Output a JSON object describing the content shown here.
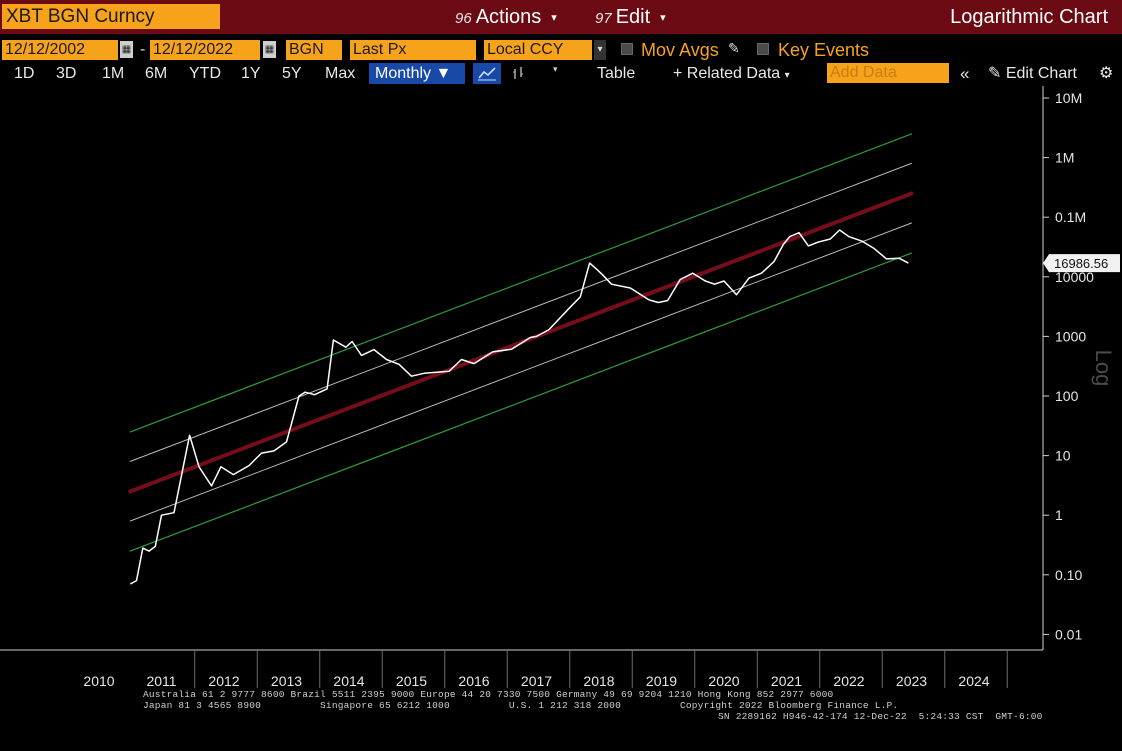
{
  "header": {
    "security": "XBT BGN Curncy",
    "actions_num": "96",
    "actions_label": "Actions",
    "edit_num": "97",
    "edit_label": "Edit",
    "chart_mode": "Logarithmic Chart"
  },
  "params": {
    "start_date": "12/12/2002",
    "end_date": "12/12/2022",
    "source": "BGN",
    "field": "Last Px",
    "currency": "Local CCY",
    "mov_avgs": "Mov Avgs",
    "key_events": "Key Events"
  },
  "toolbar": {
    "ranges": [
      "1D",
      "3D",
      "1M",
      "6M",
      "YTD",
      "1Y",
      "5Y",
      "Max"
    ],
    "period": "Monthly",
    "table": "Table",
    "related_data": "Related Data",
    "add_data": "Add Data",
    "edit_chart": "Edit Chart"
  },
  "footer": {
    "line1": "Australia 61 2 9777 8600 Brazil 5511 2395 9000 Europe 44 20 7330 7500 Germany 49 69 9204 1210 Hong Kong 852 2977 6000",
    "line2": "Japan 81 3 4565 8900          Singapore 65 6212 1000          U.S. 1 212 318 2000          Copyright 2022 Bloomberg Finance L.P.",
    "line3": "SN 2289162 H946-42-174 12-Dec-22  5:24:33 CST  GMT-6:00"
  },
  "colors": {
    "price_line": "#ffffff",
    "outer_bands": "#2f9e3a",
    "inner_bands": "#b8b8b8",
    "center_band": "#8a1020",
    "accent_orange": "#f7a21b",
    "title_bar": "#6b0a12"
  },
  "chart_data": {
    "type": "line",
    "title": "",
    "xlabel": "",
    "ylabel": "Log",
    "scale": "log",
    "ylim": [
      0.01,
      10000000
    ],
    "y_ticks": [
      "10M",
      "1M",
      "0.1M",
      "10000",
      "1000",
      "100",
      "10",
      "1",
      "0.10",
      "0.01"
    ],
    "x_ticks": [
      "2010",
      "2011",
      "2012",
      "2013",
      "2014",
      "2015",
      "2016",
      "2017",
      "2018",
      "2019",
      "2020",
      "2021",
      "2022",
      "2023",
      "2024"
    ],
    "last_value_label": "16986.56",
    "grid": false,
    "series": [
      {
        "type": "price",
        "x": [
          2010.5,
          2010.6,
          2010.7,
          2010.8,
          2010.9,
          2011.0,
          2011.2,
          2011.45,
          2011.6,
          2011.8,
          2011.95,
          2012.15,
          2012.4,
          2012.6,
          2012.8,
          2013.0,
          2013.2,
          2013.3,
          2013.45,
          2013.65,
          2013.75,
          2013.95,
          2014.05,
          2014.2,
          2014.4,
          2014.6,
          2014.8,
          2015.0,
          2015.2,
          2015.4,
          2015.6,
          2015.8,
          2016.0,
          2016.3,
          2016.6,
          2016.9,
          2017.0,
          2017.2,
          2017.5,
          2017.7,
          2017.85,
          2017.95,
          2018.05,
          2018.2,
          2018.5,
          2018.8,
          2018.95,
          2019.1,
          2019.3,
          2019.5,
          2019.7,
          2019.85,
          2020.0,
          2020.2,
          2020.4,
          2020.6,
          2020.8,
          2020.95,
          2021.05,
          2021.2,
          2021.35,
          2021.5,
          2021.7,
          2021.85,
          2022.0,
          2022.2,
          2022.4,
          2022.6,
          2022.8,
          2022.95
        ],
        "y": [
          0.07,
          0.08,
          0.28,
          0.25,
          0.3,
          1,
          1.1,
          22,
          6.5,
          3.1,
          6.5,
          4.8,
          6.8,
          11,
          12,
          17,
          100,
          116,
          105,
          132,
          870,
          660,
          820,
          480,
          600,
          410,
          340,
          215,
          240,
          250,
          260,
          410,
          350,
          550,
          610,
          960,
          1000,
          1300,
          2800,
          4600,
          17000,
          13800,
          11000,
          7500,
          6500,
          4100,
          3700,
          4000,
          9000,
          11500,
          8500,
          7500,
          8500,
          5000,
          9500,
          11500,
          18000,
          35000,
          47000,
          55000,
          33000,
          38000,
          43000,
          61000,
          47000,
          40000,
          30000,
          20000,
          20500,
          16986.56
        ]
      },
      {
        "type": "band-outer-upper",
        "x": [
          2010.5,
          2023.0
        ],
        "y": [
          25,
          2500000
        ]
      },
      {
        "type": "band-inner-upper",
        "x": [
          2010.5,
          2023.0
        ],
        "y": [
          8,
          800000
        ]
      },
      {
        "type": "band-center",
        "x": [
          2010.5,
          2023.0
        ],
        "y": [
          2.5,
          250000
        ]
      },
      {
        "type": "band-inner-lower",
        "x": [
          2010.5,
          2023.0
        ],
        "y": [
          0.8,
          80000
        ]
      },
      {
        "type": "band-outer-lower",
        "x": [
          2010.5,
          2023.0
        ],
        "y": [
          0.25,
          25000
        ]
      }
    ]
  }
}
